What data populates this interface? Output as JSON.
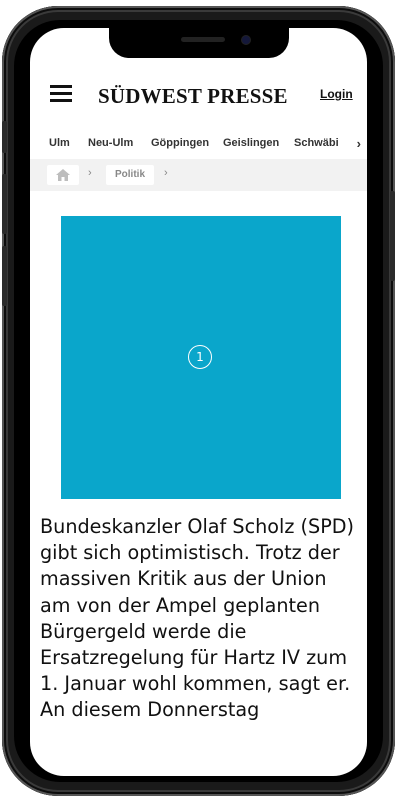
{
  "header": {
    "logo": "SÜDWEST PRESSE",
    "login_label": "Login"
  },
  "region_nav": {
    "items": [
      "Ulm",
      "Neu-Ulm",
      "Göppingen",
      "Geislingen",
      "Schwäbi"
    ],
    "more_icon": "chevron-right-icon"
  },
  "breadcrumb": {
    "home_icon": "home-icon",
    "separator": "›",
    "section": "Politik"
  },
  "hero": {
    "badge": "1",
    "color": "#0aa6cb"
  },
  "article": {
    "teaser": "Bundeskanzler Olaf Scholz (SPD) gibt sich optimistisch. Trotz der massiven Kritik aus der Union am von der Ampel geplanten Bürgergeld werde die Ersatzregelung für Hartz IV zum 1. Januar wohl kommen, sagt er. An diesem Donnerstag"
  }
}
